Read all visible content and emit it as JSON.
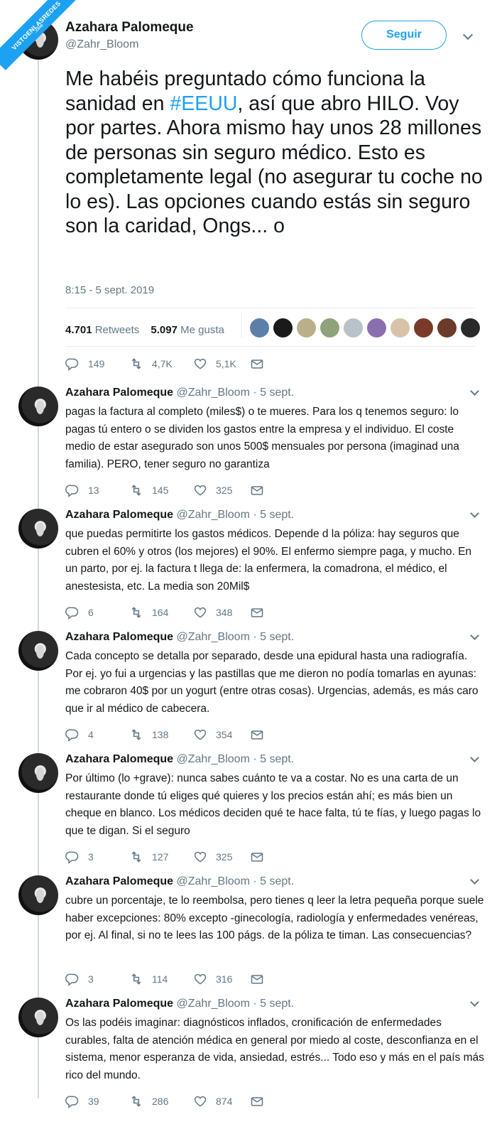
{
  "watermark": {
    "text": "VISTOENLASREDES",
    "sub": ".com"
  },
  "main": {
    "name": "Azahara Palomeque",
    "handle": "@Zahr_Bloom",
    "follow_label": "Seguir",
    "text_before": "Me habéis preguntado cómo funciona la sanidad en ",
    "hashtag": "#EEUU",
    "text_after": ", así que abro HILO. Voy por partes. Ahora mismo hay unos 28 millones de personas sin seguro médico. Esto es completamente legal (no asegurar tu coche no lo es). Las opciones cuando estás sin seguro son la caridad, Ongs... o",
    "time": "8:15 - 5 sept. 2019",
    "retweets_count": "4.701",
    "retweets_label": "Retweets",
    "likes_count": "5.097",
    "likes_label": "Me gusta",
    "liker_colors": [
      "#5b7fa8",
      "#1a1a1a",
      "#b9b08a",
      "#8fa37a",
      "#b8c2c8",
      "#8a6fb0",
      "#d8c2a8",
      "#7a3a2a",
      "#6a3a2a",
      "#2a2a2a"
    ],
    "actions": {
      "replies": "149",
      "retweets": "4,7K",
      "likes": "5,1K"
    }
  },
  "replies": [
    {
      "name": "Azahara Palomeque",
      "handle": "@Zahr_Bloom",
      "date": "5 sept.",
      "text": "pagas la factura al completo (miles$) o te mueres. Para los q tenemos seguro: lo pagas tú entero o se dividen los gastos entre la empresa y el individuo. El coste medio de estar asegurado son unos 500$ mensuales por persona (imaginad una familia). PERO, tener seguro no garantiza",
      "replies": "13",
      "retweets": "145",
      "likes": "325"
    },
    {
      "name": "Azahara Palomeque",
      "handle": "@Zahr_Bloom",
      "date": "5 sept.",
      "text": "que puedas permitirte los gastos médicos. Depende d la póliza: hay seguros que cubren el 60% y otros (los mejores) el 90%. El enfermo siempre paga, y mucho. En un parto, por ej. la factura t llega de: la enfermera, la comadrona, el médico, el anestesista, etc. La media son 20Mil$",
      "replies": "6",
      "retweets": "164",
      "likes": "348"
    },
    {
      "name": "Azahara Palomeque",
      "handle": "@Zahr_Bloom",
      "date": "5 sept.",
      "text": "Cada concepto se detalla por separado, desde una epidural hasta una radiografía. Por ej. yo fui a urgencias y las pastillas que me dieron no podía tomarlas en ayunas: me cobraron 40$ por un yogurt (entre otras cosas). Urgencias, además, es más caro que ir al médico de cabecera.",
      "replies": "4",
      "retweets": "138",
      "likes": "354"
    },
    {
      "name": "Azahara Palomeque",
      "handle": "@Zahr_Bloom",
      "date": "5 sept.",
      "text": "Por último (lo +grave): nunca sabes cuánto te va a costar. No es una carta de un restaurante donde tú eliges qué quieres y los precios están ahí; es más bien un cheque en blanco. Los médicos deciden qué te hace falta, tú te fías, y luego pagas lo que te digan. Si el seguro",
      "replies": "3",
      "retweets": "127",
      "likes": "325"
    },
    {
      "name": "Azahara Palomeque",
      "handle": "@Zahr_Bloom",
      "date": "5 sept.",
      "text": "cubre un porcentaje, te lo reembolsa, pero tienes q leer la letra pequeña porque suele haber excepciones: 80% excepto -ginecología, radiología y enfermedades venéreas, por ej. Al final, si no te lees las 100 págs. de la póliza te timan. Las consecuencias?",
      "replies": "3",
      "retweets": "114",
      "likes": "316"
    },
    {
      "name": "Azahara Palomeque",
      "handle": "@Zahr_Bloom",
      "date": "5 sept.",
      "text": "Os las podéis imaginar: diagnósticos inflados, cronificación de enfermedades curables, falta de atención médica en general por miedo al coste, desconfianza en el sistema, menor esperanza de vida, ansiedad, estrés... Todo eso y más en el país más rico del mundo.",
      "replies": "39",
      "retweets": "286",
      "likes": "874"
    }
  ]
}
